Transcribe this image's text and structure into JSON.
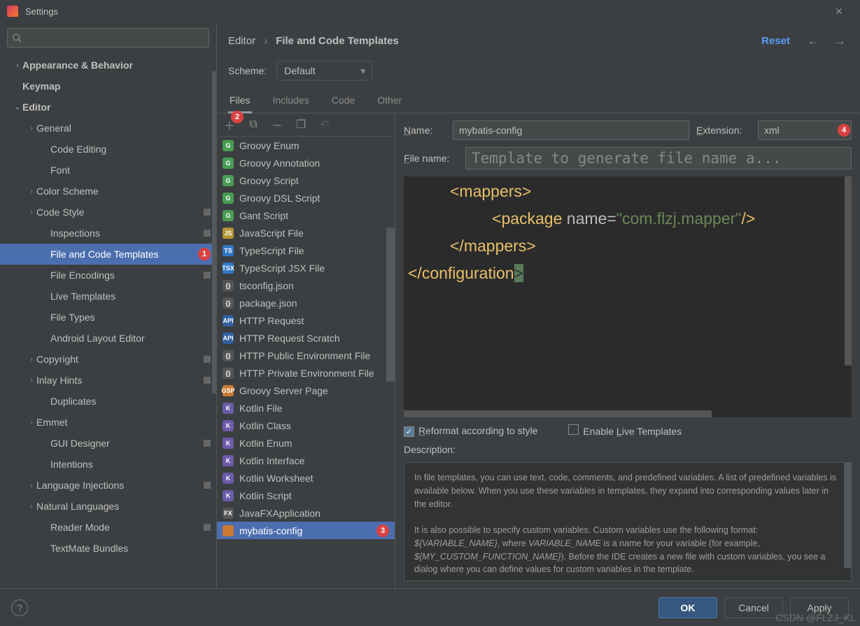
{
  "window": {
    "title": "Settings"
  },
  "search": {
    "placeholder": ""
  },
  "tree": [
    {
      "label": "Appearance & Behavior",
      "depth": 0,
      "chev": ">",
      "bold": true
    },
    {
      "label": "Keymap",
      "depth": 0,
      "bold": true
    },
    {
      "label": "Editor",
      "depth": 0,
      "chev": "v",
      "bold": true
    },
    {
      "label": "General",
      "depth": 1,
      "chev": ">"
    },
    {
      "label": "Code Editing",
      "depth": 2
    },
    {
      "label": "Font",
      "depth": 2
    },
    {
      "label": "Color Scheme",
      "depth": 1,
      "chev": ">"
    },
    {
      "label": "Code Style",
      "depth": 1,
      "chev": ">",
      "sq": true
    },
    {
      "label": "Inspections",
      "depth": 2,
      "sq": true
    },
    {
      "label": "File and Code Templates",
      "depth": 2,
      "selected": true,
      "badge": "1"
    },
    {
      "label": "File Encodings",
      "depth": 2,
      "sq": true
    },
    {
      "label": "Live Templates",
      "depth": 2
    },
    {
      "label": "File Types",
      "depth": 2
    },
    {
      "label": "Android Layout Editor",
      "depth": 2
    },
    {
      "label": "Copyright",
      "depth": 1,
      "chev": ">",
      "sq": true
    },
    {
      "label": "Inlay Hints",
      "depth": 1,
      "chev": ">",
      "sq": true
    },
    {
      "label": "Duplicates",
      "depth": 2
    },
    {
      "label": "Emmet",
      "depth": 1,
      "chev": ">"
    },
    {
      "label": "GUI Designer",
      "depth": 2,
      "sq": true
    },
    {
      "label": "Intentions",
      "depth": 2
    },
    {
      "label": "Language Injections",
      "depth": 1,
      "chev": ">",
      "sq": true
    },
    {
      "label": "Natural Languages",
      "depth": 1,
      "chev": ">"
    },
    {
      "label": "Reader Mode",
      "depth": 2,
      "sq": true
    },
    {
      "label": "TextMate Bundles",
      "depth": 2
    }
  ],
  "crumb1": "Editor",
  "crumb2": "File and Code Templates",
  "reset": "Reset",
  "scheme_label": "Scheme:",
  "scheme_value": "Default",
  "tabs": [
    "Files",
    "Includes",
    "Code",
    "Other"
  ],
  "toolbar_badge": "2",
  "templates": [
    {
      "label": "Groovy Enum",
      "cls": "g",
      "i": "G"
    },
    {
      "label": "Groovy Annotation",
      "cls": "g",
      "i": "G"
    },
    {
      "label": "Groovy Script",
      "cls": "g",
      "i": "G"
    },
    {
      "label": "Groovy DSL Script",
      "cls": "g",
      "i": "G"
    },
    {
      "label": "Gant Script",
      "cls": "g",
      "i": "G"
    },
    {
      "label": "JavaScript File",
      "cls": "js",
      "i": "JS"
    },
    {
      "label": "TypeScript File",
      "cls": "ts",
      "i": "TS"
    },
    {
      "label": "TypeScript JSX File",
      "cls": "tsx",
      "i": "TSX"
    },
    {
      "label": "tsconfig.json",
      "cls": "jf",
      "i": "{}"
    },
    {
      "label": "package.json",
      "cls": "jf",
      "i": "{}"
    },
    {
      "label": "HTTP Request",
      "cls": "api",
      "i": "API"
    },
    {
      "label": "HTTP Request Scratch",
      "cls": "api",
      "i": "API"
    },
    {
      "label": "HTTP Public Environment File",
      "cls": "jf",
      "i": "{}"
    },
    {
      "label": "HTTP Private Environment File",
      "cls": "jf",
      "i": "{}"
    },
    {
      "label": "Groovy Server Page",
      "cls": "gsp",
      "i": "GSP"
    },
    {
      "label": "Kotlin File",
      "cls": "kt",
      "i": "K"
    },
    {
      "label": "Kotlin Class",
      "cls": "kt",
      "i": "K"
    },
    {
      "label": "Kotlin Enum",
      "cls": "kt",
      "i": "K"
    },
    {
      "label": "Kotlin Interface",
      "cls": "kt",
      "i": "K"
    },
    {
      "label": "Kotlin Worksheet",
      "cls": "kt",
      "i": "K"
    },
    {
      "label": "Kotlin Script",
      "cls": "kt",
      "i": "K"
    },
    {
      "label": "JavaFXApplication",
      "cls": "fx",
      "i": "FX"
    },
    {
      "label": "mybatis-config",
      "cls": "xml",
      "i": "</>",
      "sel": true,
      "badge": "3"
    }
  ],
  "name_label": "Name:",
  "name_value": "mybatis-config",
  "ext_label": "Extension:",
  "ext_value": "xml",
  "ext_badge": "4",
  "filename_label": "File name:",
  "filename_placeholder": "Template to generate file name a...",
  "code": {
    "l1a": "<mappers>",
    "l2a": "<",
    "l2b": "package ",
    "l2c": "name",
    "l2d": "=",
    "l2e": "\"com.flzj.mapper\"",
    "l2f": "/>",
    "l3": "</mappers>",
    "l4a": "</",
    "l4b": "configuration",
    "l4c": ">"
  },
  "cb_reformat": "Reformat according to style",
  "cb_live": "Enable Live Templates",
  "desc_label": "Description:",
  "desc_p1": "In file templates, you can use text, code, comments, and predefined variables. A list of predefined variables is available below. When you use these variables in templates, they expand into corresponding values later in the editor.",
  "desc_p2a": "It is also possible to specify custom variables. Custom variables use the following format: ",
  "desc_p2b": "${VARIABLE_NAME}",
  "desc_p2c": ", where ",
  "desc_p2d": "VARIABLE_NAME",
  "desc_p2e": " is a name for your variable (for example, ",
  "desc_p2f": "${MY_CUSTOM_FUNCTION_NAME}",
  "desc_p2g": "). Before the IDE creates a new file with custom variables, you see a dialog where you can define values for custom variables in the template.",
  "btn_ok": "OK",
  "btn_cancel": "Cancel",
  "btn_apply": "Apply",
  "watermark": "CSDN @FLZJ_KL"
}
